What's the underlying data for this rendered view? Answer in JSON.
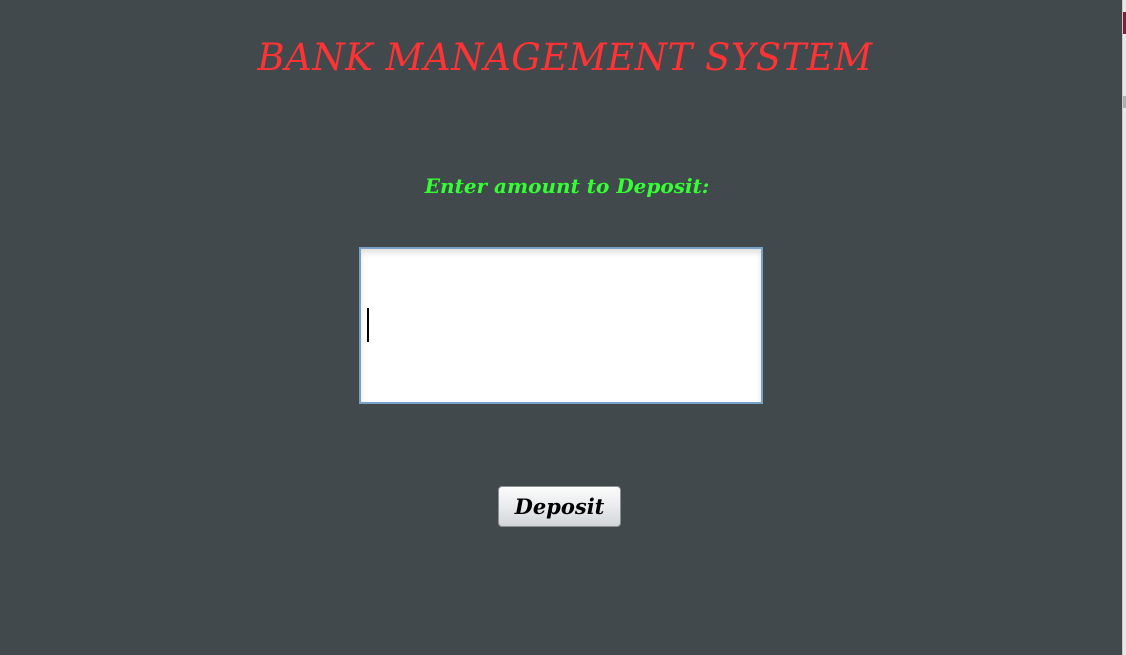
{
  "app": {
    "title": "BANK MANAGEMENT SYSTEM"
  },
  "deposit_form": {
    "prompt": "Enter amount to Deposit:",
    "amount_value": "",
    "deposit_label": "Deposit"
  },
  "colors": {
    "background": "#42494d",
    "title": "#ff3333",
    "prompt": "#33ff33",
    "field_border": "#7aa2c6"
  }
}
